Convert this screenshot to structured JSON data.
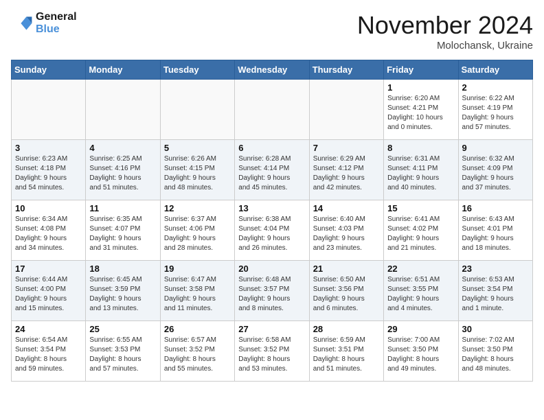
{
  "header": {
    "logo_line1": "General",
    "logo_line2": "Blue",
    "month_title": "November 2024",
    "location": "Molochansk, Ukraine"
  },
  "weekdays": [
    "Sunday",
    "Monday",
    "Tuesday",
    "Wednesday",
    "Thursday",
    "Friday",
    "Saturday"
  ],
  "weeks": [
    [
      {
        "day": "",
        "info": ""
      },
      {
        "day": "",
        "info": ""
      },
      {
        "day": "",
        "info": ""
      },
      {
        "day": "",
        "info": ""
      },
      {
        "day": "",
        "info": ""
      },
      {
        "day": "1",
        "info": "Sunrise: 6:20 AM\nSunset: 4:21 PM\nDaylight: 10 hours\nand 0 minutes."
      },
      {
        "day": "2",
        "info": "Sunrise: 6:22 AM\nSunset: 4:19 PM\nDaylight: 9 hours\nand 57 minutes."
      }
    ],
    [
      {
        "day": "3",
        "info": "Sunrise: 6:23 AM\nSunset: 4:18 PM\nDaylight: 9 hours\nand 54 minutes."
      },
      {
        "day": "4",
        "info": "Sunrise: 6:25 AM\nSunset: 4:16 PM\nDaylight: 9 hours\nand 51 minutes."
      },
      {
        "day": "5",
        "info": "Sunrise: 6:26 AM\nSunset: 4:15 PM\nDaylight: 9 hours\nand 48 minutes."
      },
      {
        "day": "6",
        "info": "Sunrise: 6:28 AM\nSunset: 4:14 PM\nDaylight: 9 hours\nand 45 minutes."
      },
      {
        "day": "7",
        "info": "Sunrise: 6:29 AM\nSunset: 4:12 PM\nDaylight: 9 hours\nand 42 minutes."
      },
      {
        "day": "8",
        "info": "Sunrise: 6:31 AM\nSunset: 4:11 PM\nDaylight: 9 hours\nand 40 minutes."
      },
      {
        "day": "9",
        "info": "Sunrise: 6:32 AM\nSunset: 4:09 PM\nDaylight: 9 hours\nand 37 minutes."
      }
    ],
    [
      {
        "day": "10",
        "info": "Sunrise: 6:34 AM\nSunset: 4:08 PM\nDaylight: 9 hours\nand 34 minutes."
      },
      {
        "day": "11",
        "info": "Sunrise: 6:35 AM\nSunset: 4:07 PM\nDaylight: 9 hours\nand 31 minutes."
      },
      {
        "day": "12",
        "info": "Sunrise: 6:37 AM\nSunset: 4:06 PM\nDaylight: 9 hours\nand 28 minutes."
      },
      {
        "day": "13",
        "info": "Sunrise: 6:38 AM\nSunset: 4:04 PM\nDaylight: 9 hours\nand 26 minutes."
      },
      {
        "day": "14",
        "info": "Sunrise: 6:40 AM\nSunset: 4:03 PM\nDaylight: 9 hours\nand 23 minutes."
      },
      {
        "day": "15",
        "info": "Sunrise: 6:41 AM\nSunset: 4:02 PM\nDaylight: 9 hours\nand 21 minutes."
      },
      {
        "day": "16",
        "info": "Sunrise: 6:43 AM\nSunset: 4:01 PM\nDaylight: 9 hours\nand 18 minutes."
      }
    ],
    [
      {
        "day": "17",
        "info": "Sunrise: 6:44 AM\nSunset: 4:00 PM\nDaylight: 9 hours\nand 15 minutes."
      },
      {
        "day": "18",
        "info": "Sunrise: 6:45 AM\nSunset: 3:59 PM\nDaylight: 9 hours\nand 13 minutes."
      },
      {
        "day": "19",
        "info": "Sunrise: 6:47 AM\nSunset: 3:58 PM\nDaylight: 9 hours\nand 11 minutes."
      },
      {
        "day": "20",
        "info": "Sunrise: 6:48 AM\nSunset: 3:57 PM\nDaylight: 9 hours\nand 8 minutes."
      },
      {
        "day": "21",
        "info": "Sunrise: 6:50 AM\nSunset: 3:56 PM\nDaylight: 9 hours\nand 6 minutes."
      },
      {
        "day": "22",
        "info": "Sunrise: 6:51 AM\nSunset: 3:55 PM\nDaylight: 9 hours\nand 4 minutes."
      },
      {
        "day": "23",
        "info": "Sunrise: 6:53 AM\nSunset: 3:54 PM\nDaylight: 9 hours\nand 1 minute."
      }
    ],
    [
      {
        "day": "24",
        "info": "Sunrise: 6:54 AM\nSunset: 3:54 PM\nDaylight: 8 hours\nand 59 minutes."
      },
      {
        "day": "25",
        "info": "Sunrise: 6:55 AM\nSunset: 3:53 PM\nDaylight: 8 hours\nand 57 minutes."
      },
      {
        "day": "26",
        "info": "Sunrise: 6:57 AM\nSunset: 3:52 PM\nDaylight: 8 hours\nand 55 minutes."
      },
      {
        "day": "27",
        "info": "Sunrise: 6:58 AM\nSunset: 3:52 PM\nDaylight: 8 hours\nand 53 minutes."
      },
      {
        "day": "28",
        "info": "Sunrise: 6:59 AM\nSunset: 3:51 PM\nDaylight: 8 hours\nand 51 minutes."
      },
      {
        "day": "29",
        "info": "Sunrise: 7:00 AM\nSunset: 3:50 PM\nDaylight: 8 hours\nand 49 minutes."
      },
      {
        "day": "30",
        "info": "Sunrise: 7:02 AM\nSunset: 3:50 PM\nDaylight: 8 hours\nand 48 minutes."
      }
    ]
  ]
}
